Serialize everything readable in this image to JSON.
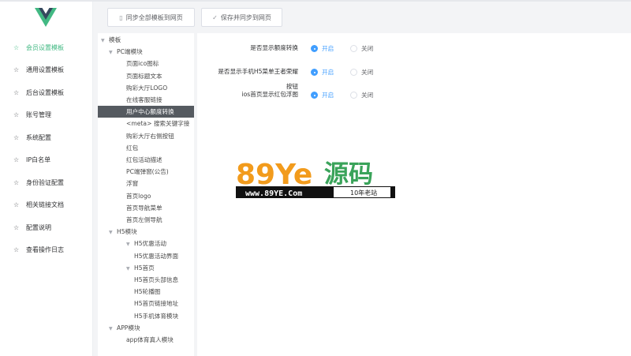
{
  "sidebar": {
    "logo_icon": "vue-logo-icon",
    "items": [
      {
        "label": "会员设置模板",
        "active": true
      },
      {
        "label": "通用设置模板"
      },
      {
        "label": "后台设置模板"
      },
      {
        "label": "账号管理"
      },
      {
        "label": "系统配置"
      },
      {
        "label": "IP白名单"
      },
      {
        "label": "身份验证配置"
      },
      {
        "label": "相关链接文档"
      },
      {
        "label": "配置说明"
      },
      {
        "label": "查看操作日志"
      }
    ]
  },
  "toolbar": {
    "sync_all_label": "同步全部模板到网页",
    "save_sync_label": "保存并同步到网页"
  },
  "tree": [
    {
      "label": "模板",
      "level": 0,
      "caret": true
    },
    {
      "label": "PC端模块",
      "level": 1,
      "caret": true
    },
    {
      "label": "页面ico图标",
      "level": 2
    },
    {
      "label": "页面标题文本",
      "level": 2
    },
    {
      "label": "购彩大厅LOGO",
      "level": 2
    },
    {
      "label": "在线客服链接",
      "level": 2
    },
    {
      "label": "用户中心额度转换",
      "level": 2,
      "selected": true
    },
    {
      "label": "<meta> 搜索关键字接",
      "level": 2
    },
    {
      "label": "购彩大厅右侧按钮",
      "level": 2
    },
    {
      "label": "红包",
      "level": 2
    },
    {
      "label": "红包活动描述",
      "level": 2
    },
    {
      "label": "PC端弹窗(公告)",
      "level": 2
    },
    {
      "label": "浮窗",
      "level": 2
    },
    {
      "label": "首页logo",
      "level": 2
    },
    {
      "label": "首页导航菜单",
      "level": 2
    },
    {
      "label": "首页左侧导航",
      "level": 2
    },
    {
      "label": "H5模块",
      "level": 1,
      "caret": true
    },
    {
      "label": "H5优惠活动",
      "level": 2,
      "caret": true
    },
    {
      "label": "H5优惠活动界面",
      "level": 3
    },
    {
      "label": "H5首页",
      "level": 2,
      "caret": true
    },
    {
      "label": "H5首页头部信息",
      "level": 3
    },
    {
      "label": "H5轮播图",
      "level": 3
    },
    {
      "label": "H5首页链接地址",
      "level": 3
    },
    {
      "label": "H5手机体育模块",
      "level": 3
    },
    {
      "label": "APP模块",
      "level": 1,
      "caret": true
    },
    {
      "label": "app体育真人模块",
      "level": 2
    }
  ],
  "settings": [
    {
      "label_lines": [
        "是否显示额度转换"
      ],
      "on_label": "开启",
      "off_label": "关闭",
      "value": "on"
    },
    {
      "label_lines": [
        "是否显示手机H5菜单王者荣耀"
      ],
      "on_label": "开启",
      "off_label": "关闭",
      "value": "on"
    },
    {
      "label_lines": [
        "按钮",
        "ios首页显示红包浮图"
      ],
      "on_label": "开启",
      "off_label": "关闭",
      "value": "on"
    }
  ],
  "watermark": {
    "brand": "89Ye源码",
    "url": "www.89YE.Com",
    "slogan": "10年老站"
  },
  "colors": {
    "accent_green": "#42b983",
    "radio_blue": "#409eff",
    "selected_bg": "#555a60"
  }
}
